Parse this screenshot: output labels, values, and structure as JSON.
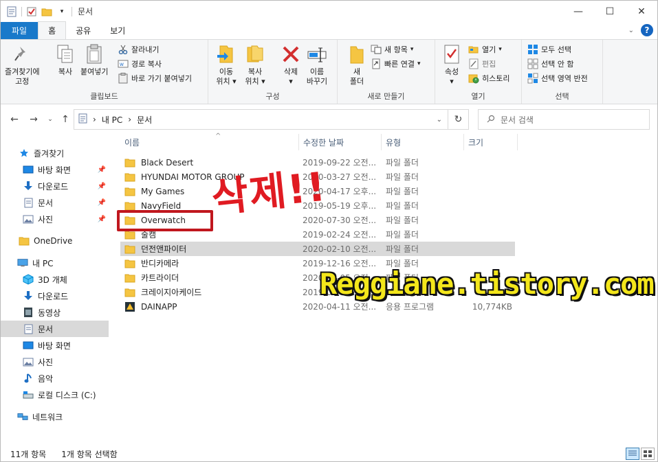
{
  "window": {
    "title": "문서",
    "controls": {
      "minimize": "—",
      "maximize": "☐",
      "close": "✕"
    }
  },
  "tabs": [
    "파일",
    "홈",
    "공유",
    "보기"
  ],
  "ribbon": {
    "clipboard": {
      "label": "클립보드",
      "pin": [
        "즐겨찾기에",
        "고정"
      ],
      "copy": "복사",
      "paste": "붙여넣기",
      "cut": "잘라내기",
      "copy_path": "경로 복사",
      "paste_shortcut": "바로 가기 붙여넣기"
    },
    "organize": {
      "label": "구성",
      "move": [
        "이동",
        "위치"
      ],
      "copy_to": [
        "복사",
        "위치"
      ],
      "delete": "삭제",
      "rename": [
        "이름",
        "바꾸기"
      ]
    },
    "new": {
      "label": "새로 만들기",
      "new_folder": [
        "새",
        "폴더"
      ],
      "new_item": "새 항목",
      "easy_access": "빠른 연결"
    },
    "open": {
      "label": "열기",
      "properties": "속성",
      "open": "열기",
      "edit": "편집",
      "history": "히스토리"
    },
    "select": {
      "label": "선택",
      "select_all": "모두 선택",
      "select_none": "선택 안 함",
      "invert": "선택 영역 반전"
    }
  },
  "address": {
    "crumbs": [
      "내 PC",
      "문서"
    ],
    "separator": "›",
    "search_placeholder": "문서 검색"
  },
  "navpane": {
    "items": [
      {
        "label": "즐겨찾기",
        "icon": "star-icon",
        "pinned": false,
        "level": 0
      },
      {
        "label": "바탕 화면",
        "icon": "desktop-icon",
        "pinned": true,
        "level": 1
      },
      {
        "label": "다운로드",
        "icon": "download-icon",
        "pinned": true,
        "level": 1
      },
      {
        "label": "문서",
        "icon": "document-icon",
        "pinned": true,
        "level": 1
      },
      {
        "label": "사진",
        "icon": "picture-icon",
        "pinned": true,
        "level": 1
      },
      {
        "label": "OneDrive",
        "icon": "folder-icon",
        "pinned": false,
        "level": 0
      },
      {
        "label": "내 PC",
        "icon": "computer-icon",
        "pinned": false,
        "level": 0
      },
      {
        "label": "3D 개체",
        "icon": "cube-icon",
        "pinned": false,
        "level": 1
      },
      {
        "label": "다운로드",
        "icon": "download-icon",
        "pinned": false,
        "level": 1
      },
      {
        "label": "동영상",
        "icon": "video-icon",
        "pinned": false,
        "level": 1
      },
      {
        "label": "문서",
        "icon": "document-icon",
        "pinned": false,
        "level": 1,
        "selected": true
      },
      {
        "label": "바탕 화면",
        "icon": "desktop-icon",
        "pinned": false,
        "level": 1
      },
      {
        "label": "사진",
        "icon": "picture-icon",
        "pinned": false,
        "level": 1
      },
      {
        "label": "음악",
        "icon": "music-icon",
        "pinned": false,
        "level": 1
      },
      {
        "label": "로컬 디스크 (C:)",
        "icon": "disk-icon",
        "pinned": false,
        "level": 1
      },
      {
        "label": "네트워크",
        "icon": "network-icon",
        "pinned": false,
        "level": 0
      }
    ]
  },
  "columns": {
    "name": "이름",
    "date": "수정한 날짜",
    "type": "유형",
    "size": "크기"
  },
  "files": [
    {
      "name": "Black Desert",
      "date": "2019-09-22 오전...",
      "type": "파일 폴더",
      "size": "",
      "icon": "folder-icon"
    },
    {
      "name": "HYUNDAI MOTOR GROUP",
      "date": "2020-03-27 오전...",
      "type": "파일 폴더",
      "size": "",
      "icon": "folder-icon"
    },
    {
      "name": "My Games",
      "date": "2020-04-17 오후...",
      "type": "파일 폴더",
      "size": "",
      "icon": "folder-icon"
    },
    {
      "name": "NavyField",
      "date": "2019-05-19 오후...",
      "type": "파일 폴더",
      "size": "",
      "icon": "folder-icon"
    },
    {
      "name": "Overwatch",
      "date": "2020-07-30 오전...",
      "type": "파일 폴더",
      "size": "",
      "icon": "folder-icon"
    },
    {
      "name": "줄캠",
      "date": "2019-02-24 오전...",
      "type": "파일 폴더",
      "size": "",
      "icon": "folder-icon"
    },
    {
      "name": "던전앤파이터",
      "date": "2020-02-10 오전...",
      "type": "파일 폴더",
      "size": "",
      "icon": "folder-icon",
      "selected": true
    },
    {
      "name": "반디카메라",
      "date": "2019-12-16 오전...",
      "type": "파일 폴더",
      "size": "",
      "icon": "folder-icon"
    },
    {
      "name": "카트라이더",
      "date": "2020-05-05 오전...",
      "type": "파일 폴더",
      "size": "",
      "icon": "folder-icon"
    },
    {
      "name": "크레이지아케이드",
      "date": "2019-0...",
      "type": "파일 폴더",
      "size": "",
      "icon": "folder-icon"
    },
    {
      "name": "DAINAPP",
      "date": "2020-04-11 오전...",
      "type": "응용 프로그램",
      "size": "10,774KB",
      "icon": "app-icon"
    }
  ],
  "status": {
    "count": "11개 항목",
    "selection": "1개 항목 선택함"
  },
  "annotations": {
    "delete": "삭제!!",
    "site": "Reggiane.tistory.com"
  },
  "colors": {
    "accent": "#1979ca",
    "annotation_red": "#e01b22",
    "annotation_yellow": "#f3e61b",
    "folder": "#f5c542"
  }
}
